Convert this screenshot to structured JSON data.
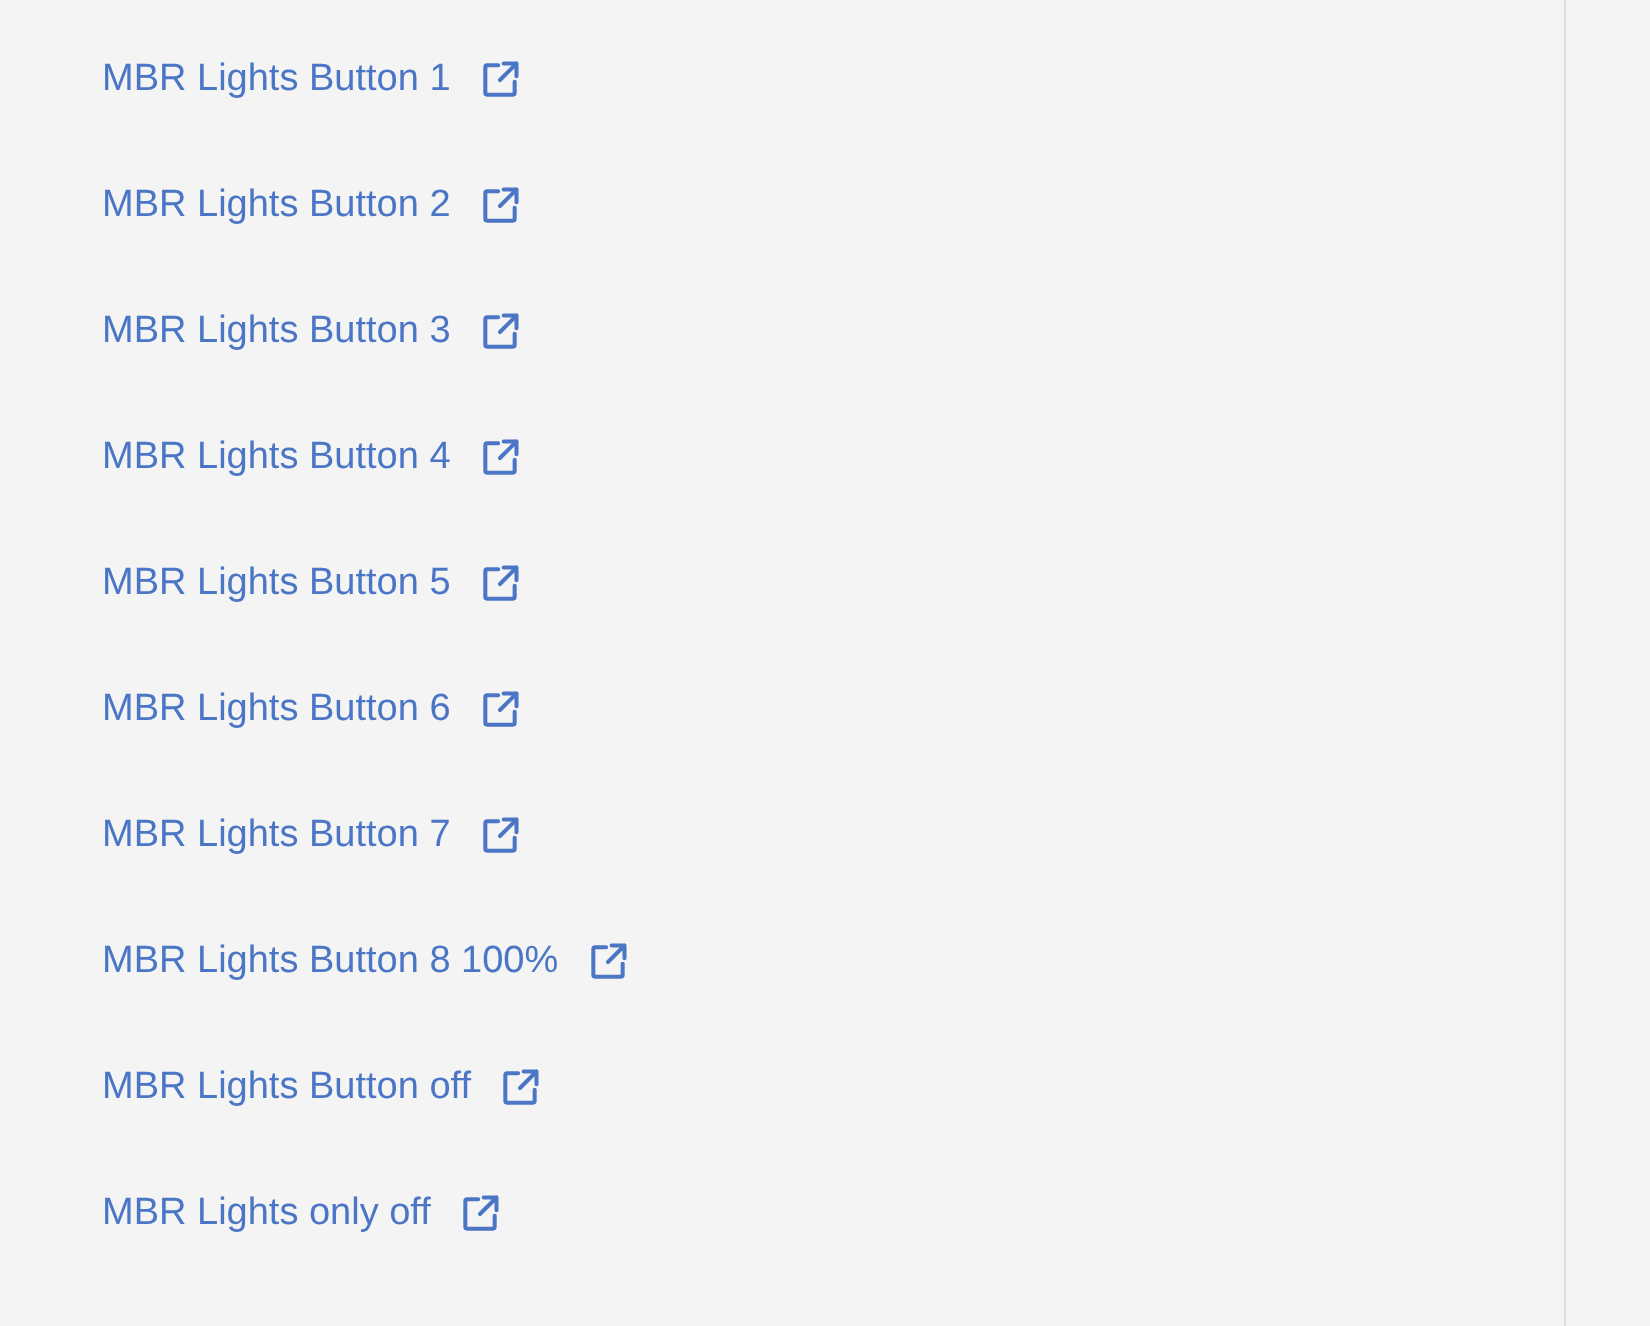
{
  "links": [
    {
      "label": "MBR Lights Button 1"
    },
    {
      "label": "MBR Lights Button 2"
    },
    {
      "label": "MBR Lights Button 3"
    },
    {
      "label": "MBR Lights Button 4"
    },
    {
      "label": "MBR Lights Button 5"
    },
    {
      "label": "MBR Lights Button 6"
    },
    {
      "label": "MBR Lights Button 7"
    },
    {
      "label": "MBR Lights Button 8 100%"
    },
    {
      "label": "MBR Lights Button off"
    },
    {
      "label": "MBR Lights only off"
    }
  ]
}
